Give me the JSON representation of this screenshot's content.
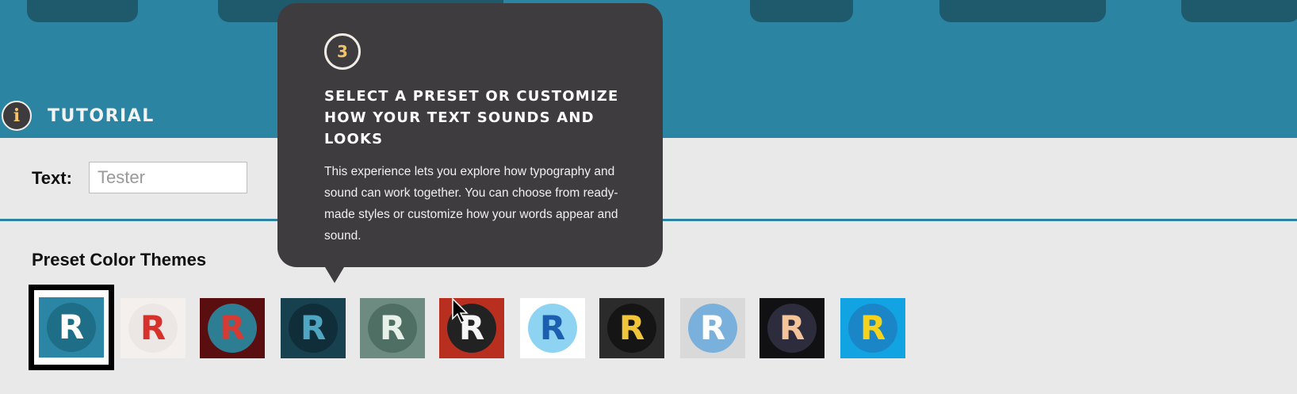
{
  "tutorial": {
    "icon": "i",
    "label": "TUTORIAL"
  },
  "text_field": {
    "label": "Text:",
    "placeholder": "Tester"
  },
  "presets": {
    "title": "Preset Color Themes",
    "swatch_letter": "R",
    "themes": [
      {
        "bg": "#2a86a4",
        "circle": "#1f6e88",
        "letter": "#ffffff",
        "selected": true
      },
      {
        "bg": "#f4f0ee",
        "circle": "#ece7e5",
        "letter": "#d8312c"
      },
      {
        "bg": "#5a0e0f",
        "circle": "#2d7d93",
        "letter": "#d63a32"
      },
      {
        "bg": "#17414f",
        "circle": "#0f2e39",
        "letter": "#4ea6c2"
      },
      {
        "bg": "#6d8b80",
        "circle": "#4f6e64",
        "letter": "#e7f1e9"
      },
      {
        "bg": "#b82f20",
        "circle": "#222222",
        "letter": "#f5f5f5"
      },
      {
        "bg": "#ffffff",
        "circle": "#8fd3f3",
        "letter": "#1c5fb0"
      },
      {
        "bg": "#2b2b2b",
        "circle": "#151515",
        "letter": "#f0c53a"
      },
      {
        "bg": "#d9d9d9",
        "circle": "#7ab0dc",
        "letter": "#ffffff"
      },
      {
        "bg": "#111114",
        "circle": "#2c2c3d",
        "letter": "#f3c49a"
      },
      {
        "bg": "#12a3e3",
        "circle": "#1b86c7",
        "letter": "#f6d21b"
      }
    ]
  },
  "tooltip": {
    "step": "3",
    "title": "Select a preset or customize how your text sounds and looks",
    "body": "This experience lets you explore how typography and sound can work together. You can choose from ready-made styles or customize how your words appear and sound."
  }
}
